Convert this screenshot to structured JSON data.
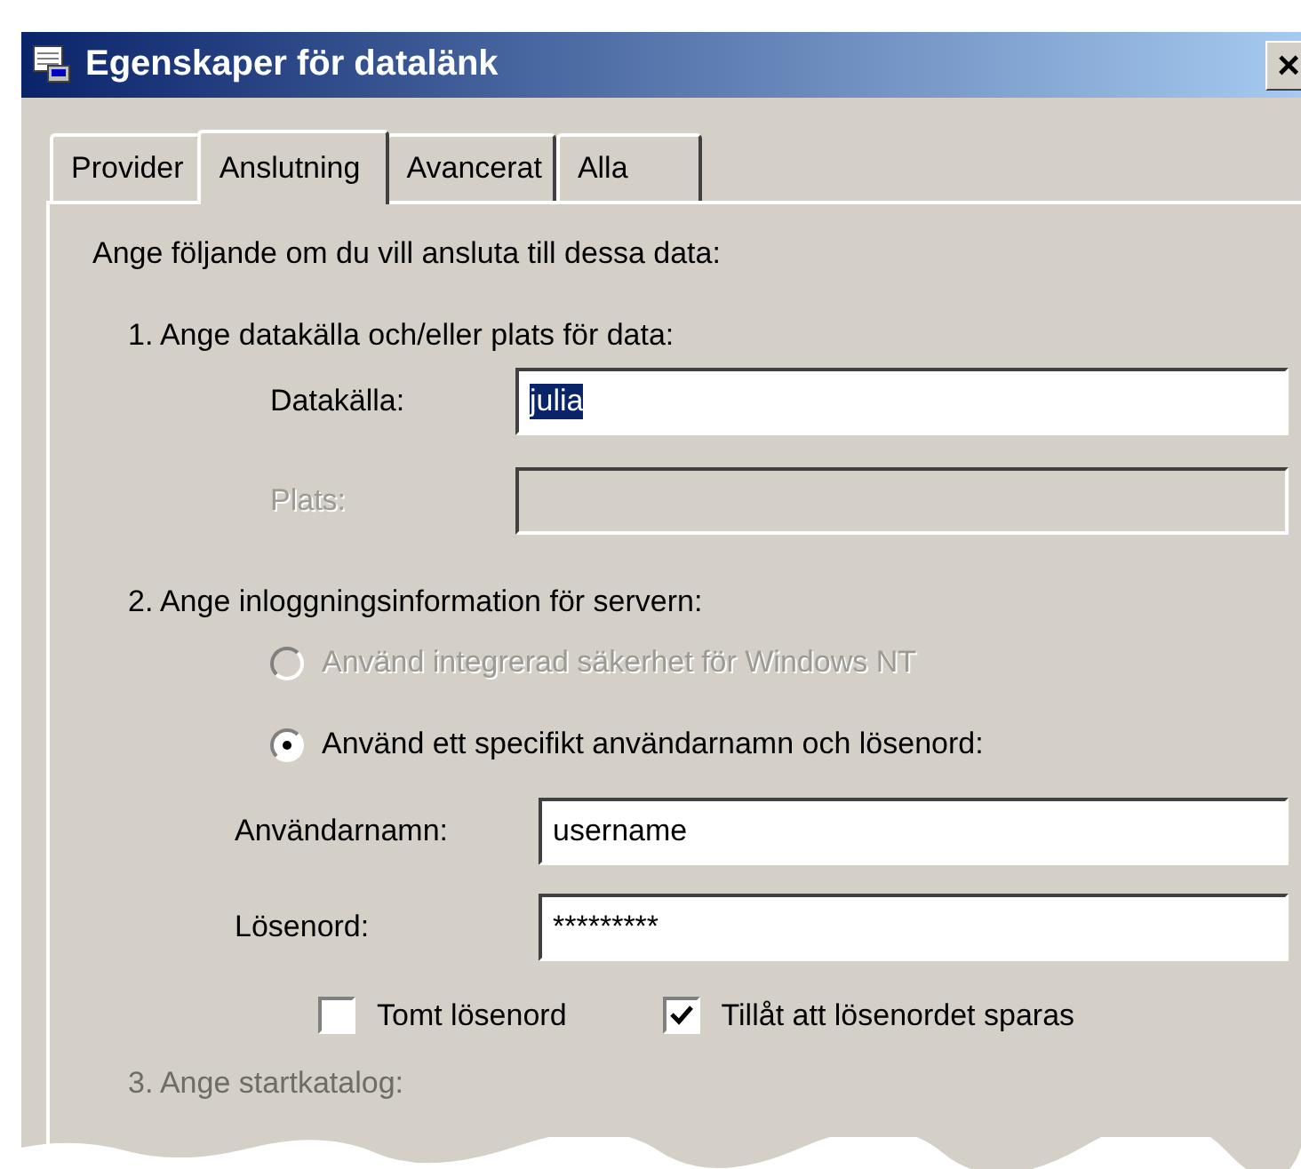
{
  "window": {
    "title": "Egenskaper för datalänk",
    "close": "×"
  },
  "tabs": [
    {
      "label": "Provider",
      "selected": false
    },
    {
      "label": "Anslutning",
      "selected": true
    },
    {
      "label": "Avancerat",
      "selected": false
    },
    {
      "label": "Alla",
      "selected": false
    }
  ],
  "intro": "Ange följande om du vill ansluta till dessa data:",
  "section_1": {
    "heading": "1. Ange datakälla och/eller plats för data:",
    "fields": [
      {
        "label": "Datakälla:",
        "value": "julia",
        "value_selected": true,
        "disabled": false
      },
      {
        "label": "Plats:",
        "disabled": true
      }
    ]
  },
  "section_2": {
    "heading": "2. Ange inloggningsinformation för servern:",
    "options": [
      {
        "label": "Använd integrerad säkerhet för Windows NT",
        "selected": false,
        "disabled": true
      },
      {
        "label": "Använd ett specifikt användarnamn och lösenord:",
        "selected": true,
        "disabled": false
      }
    ],
    "fields": [
      {
        "label": "Användarnamn:",
        "value": "username"
      },
      {
        "label": "Lösenord:",
        "value": "*********"
      }
    ],
    "checkboxes": [
      {
        "label": "Tomt lösenord",
        "checked": false
      },
      {
        "label": "Tillåt att lösenordet sparas",
        "checked": true
      }
    ]
  },
  "section_3": {
    "heading": "3. Ange startkatalog:"
  }
}
